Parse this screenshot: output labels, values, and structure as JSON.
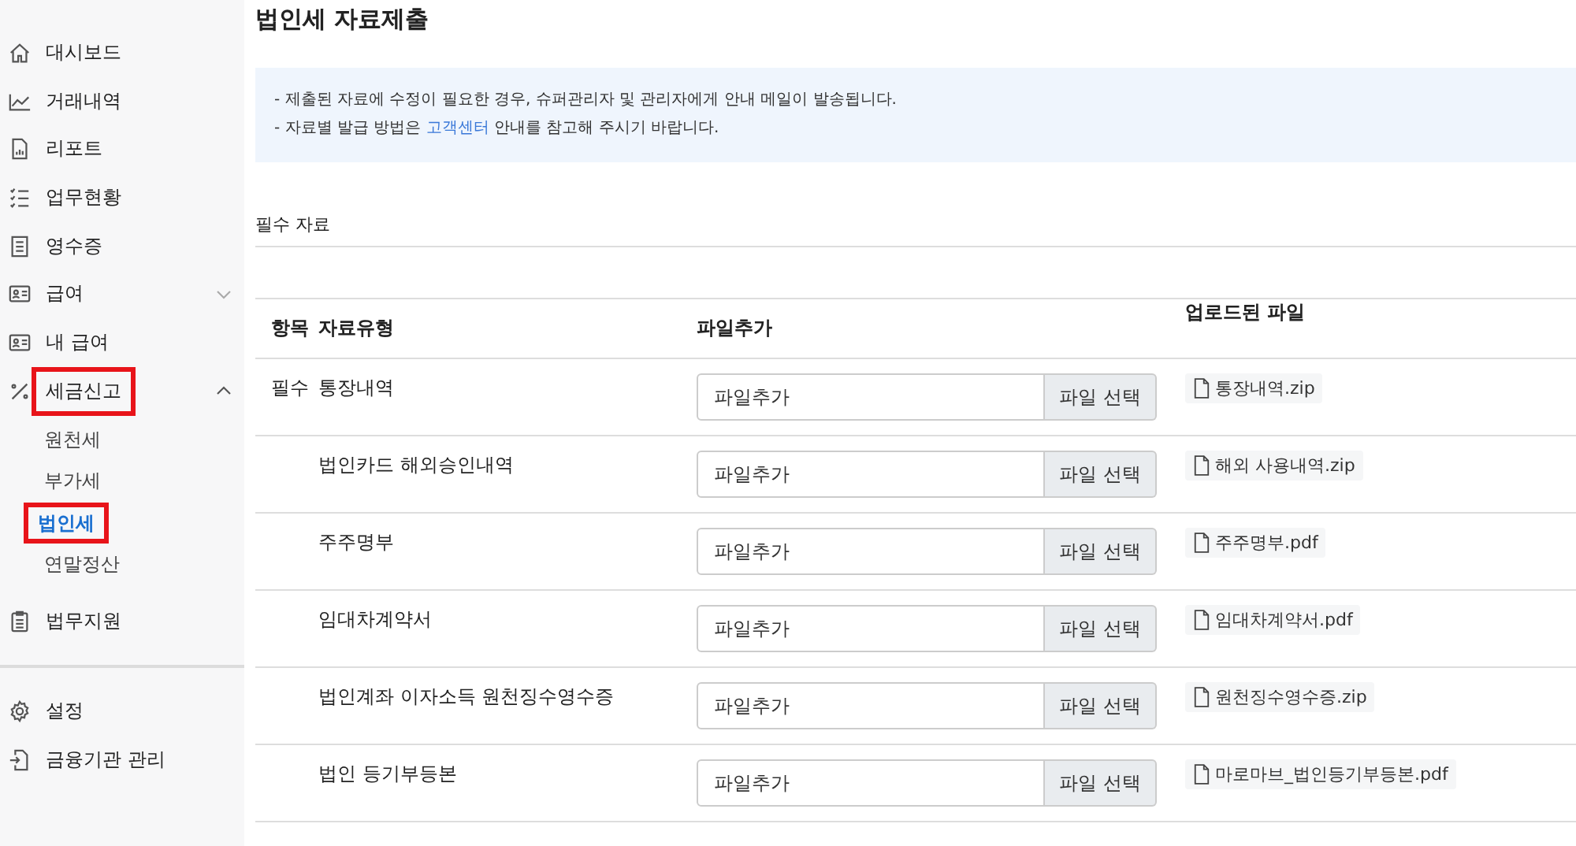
{
  "sidebar": {
    "items": [
      {
        "label": "대시보드",
        "highlighted": false
      },
      {
        "label": "거래내역",
        "highlighted": false
      },
      {
        "label": "리포트",
        "highlighted": false
      },
      {
        "label": "업무현황",
        "highlighted": false
      },
      {
        "label": "영수증",
        "highlighted": false
      },
      {
        "label": "급여",
        "expanded": false,
        "highlighted": false
      },
      {
        "label": "내 급여",
        "highlighted": false
      },
      {
        "label": "세금신고",
        "expanded": true,
        "highlighted": true,
        "children": [
          {
            "label": "원천세",
            "selected": false,
            "highlighted": false
          },
          {
            "label": "부가세",
            "selected": false,
            "highlighted": false
          },
          {
            "label": "법인세",
            "selected": true,
            "highlighted": true
          },
          {
            "label": "연말정산",
            "selected": false,
            "highlighted": false
          }
        ]
      },
      {
        "label": "법무지원",
        "highlighted": false
      }
    ],
    "bottom_items": [
      {
        "label": "설정"
      },
      {
        "label": "금융기관 관리"
      }
    ]
  },
  "page_title": "법인세 자료제출",
  "notice": {
    "lines": [
      {
        "text": "- 제출된 자료에 수정이 필요한 경우, 슈퍼관리자 및 관리자에게 안내 메일이 발송됩니다."
      },
      {
        "text": "- 자료별 발급 방법은 ",
        "link": "고객센터",
        "after": " 안내를 참고해 주시기 바랍니다."
      }
    ]
  },
  "section_title": "필수 자료",
  "table": {
    "columns": [
      "항목",
      "자료유형",
      "파일추가",
      "업로드된 파일"
    ],
    "rows": [
      {
        "category": "필수",
        "type": "통장내역",
        "placeholder": "파일추가",
        "button": "파일 선택",
        "file": "통장내역.zip"
      },
      {
        "type": "법인카드 해외승인내역",
        "placeholder": "파일추가",
        "button": "파일 선택",
        "file": "해외 사용내역.zip"
      },
      {
        "type": "주주명부",
        "placeholder": "파일추가",
        "button": "파일 선택",
        "file": "주주명부.pdf"
      },
      {
        "type": "임대차계약서",
        "placeholder": "파일추가",
        "button": "파일 선택",
        "file": "임대차계약서.pdf"
      },
      {
        "type": "법인계좌 이자소득 원천징수영수증",
        "placeholder": "파일추가",
        "button": "파일 선택",
        "file": "원천징수영수증.zip"
      },
      {
        "type": "법인 등기부등본",
        "placeholder": "파일추가",
        "button": "파일 선택",
        "file": "마로마브_법인등기부등본.pdf"
      }
    ]
  }
}
